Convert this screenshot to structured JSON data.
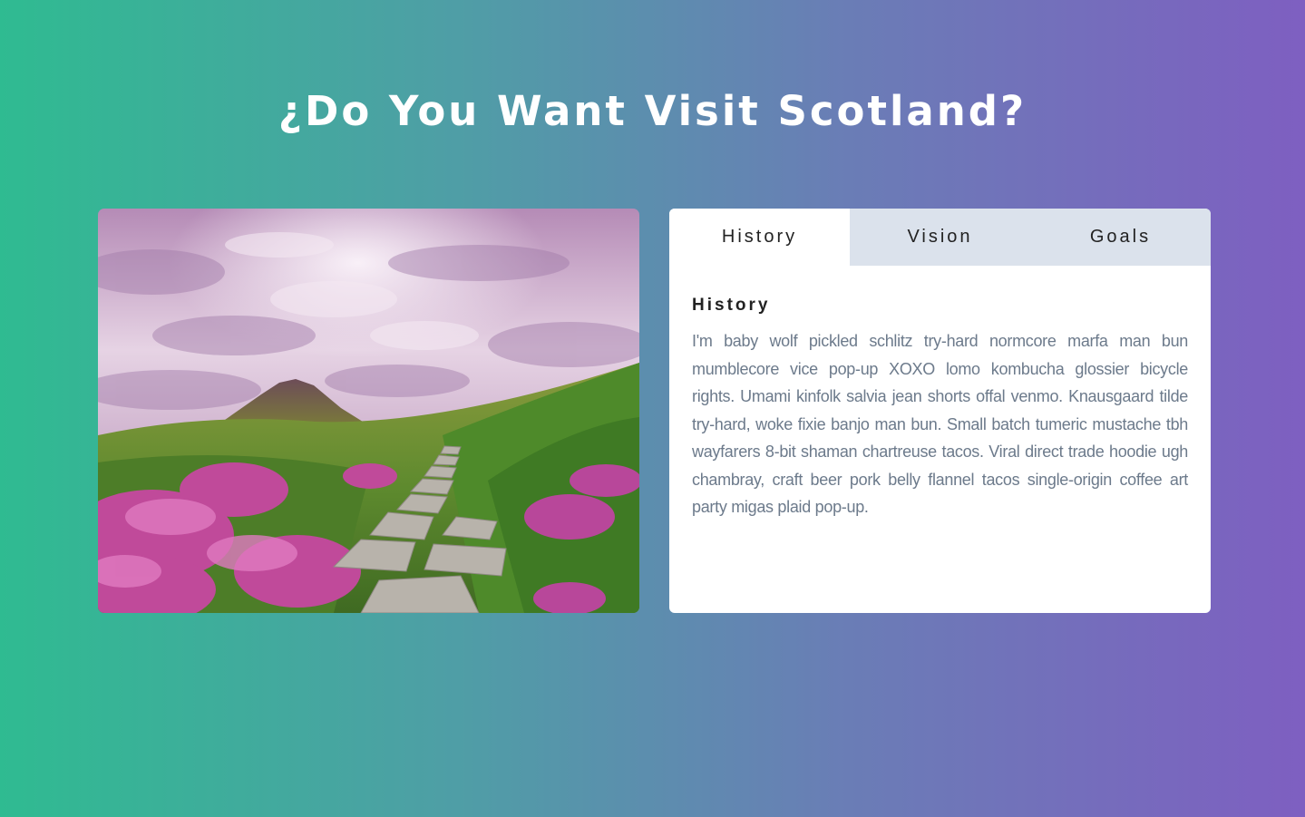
{
  "page": {
    "title": "¿Do You Want Visit Scotland?"
  },
  "image": {
    "icon": "landscape-photo"
  },
  "tabs": [
    {
      "label": "History",
      "active": true
    },
    {
      "label": "Vision",
      "active": false
    },
    {
      "label": "Goals",
      "active": false
    }
  ],
  "panel": {
    "heading": "History",
    "body": "I'm baby wolf pickled schlitz try-hard normcore marfa man bun mumblecore vice pop-up XOXO lomo kombucha glossier bicycle rights. Umami kinfolk salvia jean shorts offal venmo. Knausgaard tilde try-hard, woke fixie banjo man bun. Small batch tumeric mustache tbh wayfarers 8-bit shaman chartreuse tacos. Viral direct trade hoodie ugh chambray, craft beer pork belly flannel tacos single-origin coffee art party migas plaid pop-up."
  },
  "colors": {
    "gradient_start": "#2fbb91",
    "gradient_end": "#7e5fc1",
    "tab_inactive_bg": "#dbe2ec",
    "body_text": "#6c7a8b"
  }
}
